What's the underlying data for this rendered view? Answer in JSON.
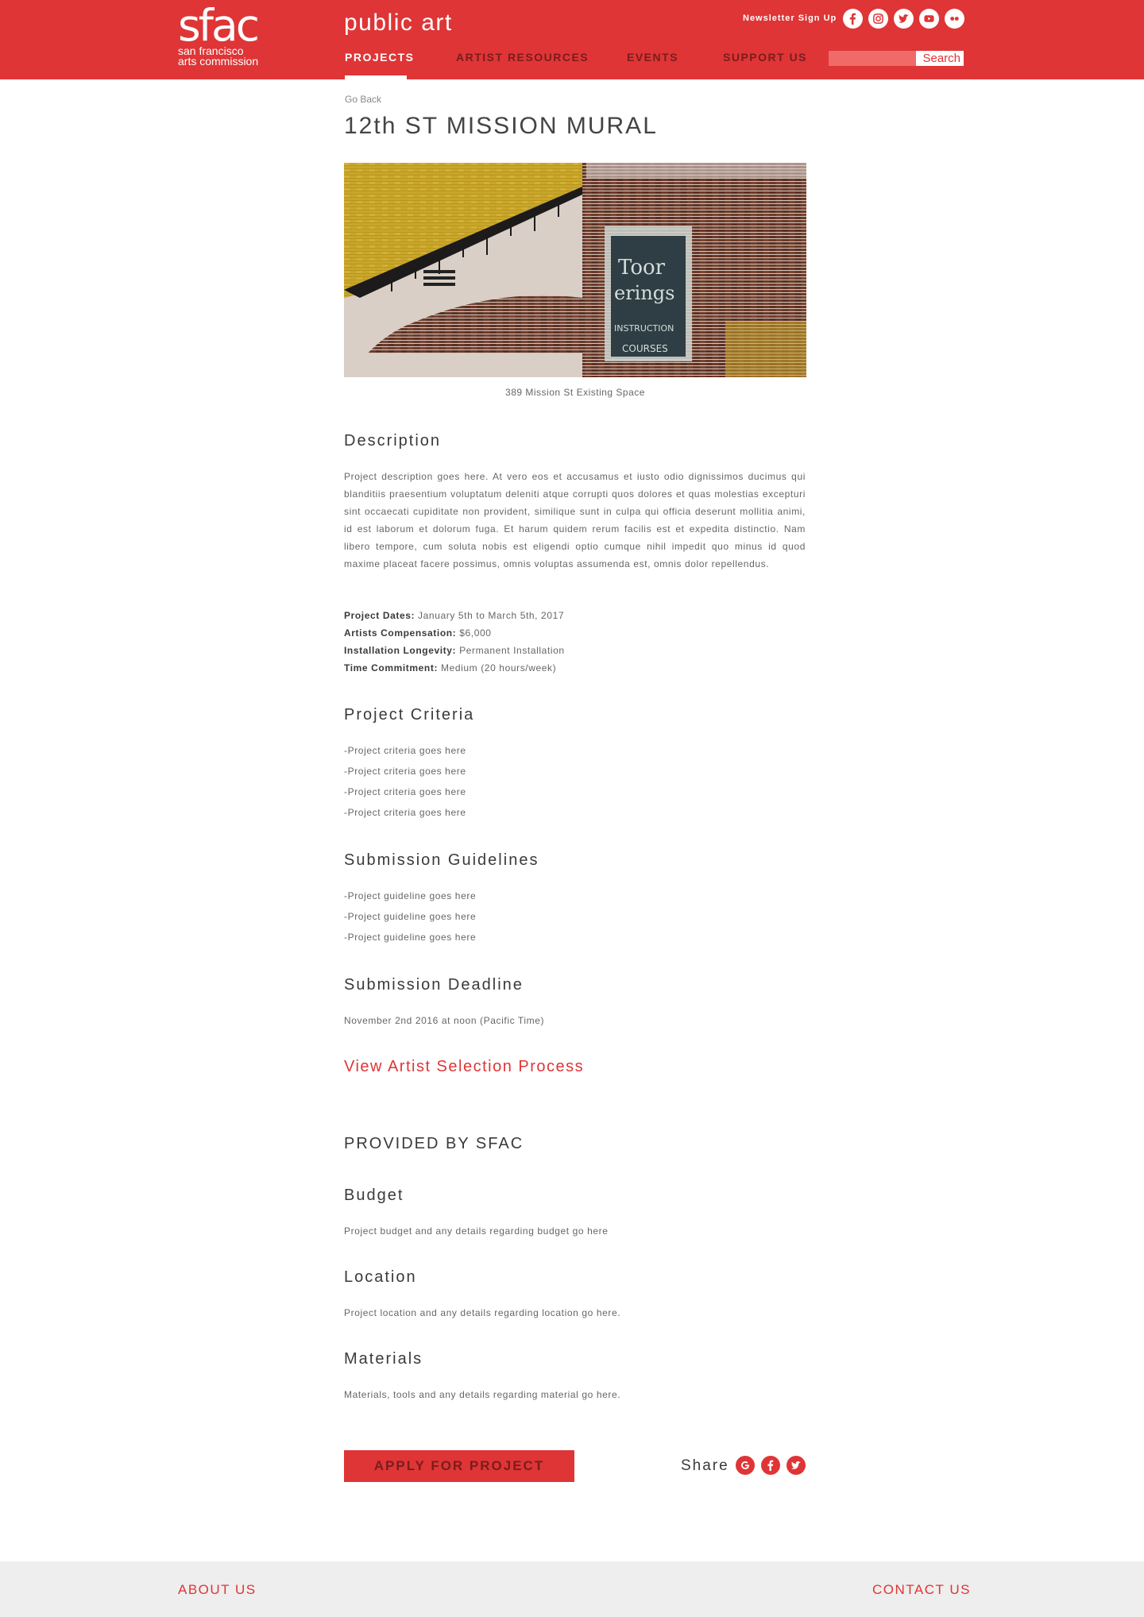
{
  "colors": {
    "brand_red": "#df3536",
    "nav_inactive": "#7a1c1d",
    "footer_bg": "#eeeeee"
  },
  "header": {
    "logo": {
      "mark": "sfac",
      "line1": "san francisco",
      "line2": "arts commission"
    },
    "site_title": "public art",
    "newsletter": "Newsletter Sign Up",
    "social_icons": [
      "facebook-icon",
      "instagram-icon",
      "twitter-icon",
      "youtube-icon",
      "flickr-icon"
    ],
    "nav": [
      "PROJECTS",
      "ARTIST RESOURCES",
      "EVENTS",
      "SUPPORT US"
    ],
    "active_nav": "PROJECTS",
    "search": {
      "value": "",
      "button": "Search"
    }
  },
  "main": {
    "go_back": "Go Back",
    "title": "12th ST MISSION MURAL",
    "image_caption": "389 Mission St Existing Space",
    "description": {
      "heading": "Description",
      "text": "Project description goes here. At vero eos et accusamus et iusto odio dignissimos ducimus qui blanditiis praesentium voluptatum deleniti atque corrupti quos dolores et quas molestias excepturi sint occaecati cupiditate non provident, similique sunt in culpa qui officia deserunt mollitia animi, id est laborum et dolorum fuga. Et harum quidem rerum facilis est et expedita distinctio. Nam libero tempore, cum soluta nobis est eligendi optio cumque nihil impedit quo minus id quod maxime placeat facere possimus, omnis voluptas assumenda est, omnis dolor repellendus."
    },
    "meta": [
      {
        "label": "Project Dates:",
        "value": "January 5th to March 5th, 2017"
      },
      {
        "label": "Artists Compensation:",
        "value": "$6,000"
      },
      {
        "label": "Installation Longevity:",
        "value": "Permanent Installation"
      },
      {
        "label": "Time Commitment:",
        "value": "Medium (20 hours/week)"
      }
    ],
    "criteria": {
      "heading": "Project Criteria",
      "items": [
        "-Project criteria goes here",
        "-Project criteria goes here",
        "-Project criteria goes here",
        "-Project criteria goes here"
      ]
    },
    "guidelines": {
      "heading": "Submission Guidelines",
      "items": [
        "-Project guideline goes here",
        "-Project guideline goes here",
        "-Project guideline goes here"
      ]
    },
    "deadline": {
      "heading": "Submission Deadline",
      "text": "November 2nd 2016 at noon (Pacific Time)"
    },
    "selection_link": "View Artist Selection Process",
    "provided_heading": "PROVIDED BY SFAC",
    "budget": {
      "heading": "Budget",
      "text": "Project budget and any details regarding budget go here"
    },
    "location": {
      "heading": "Location",
      "text": "Project location and any details regarding location go here."
    },
    "materials": {
      "heading": "Materials",
      "text": "Materials, tools and any details regarding material go here."
    },
    "apply_button": "APPLY FOR PROJECT",
    "share": {
      "label": "Share",
      "icons": [
        "google-icon",
        "facebook-icon",
        "twitter-icon"
      ]
    }
  },
  "footer": {
    "about": "ABOUT US",
    "contact": "CONTACT US"
  }
}
